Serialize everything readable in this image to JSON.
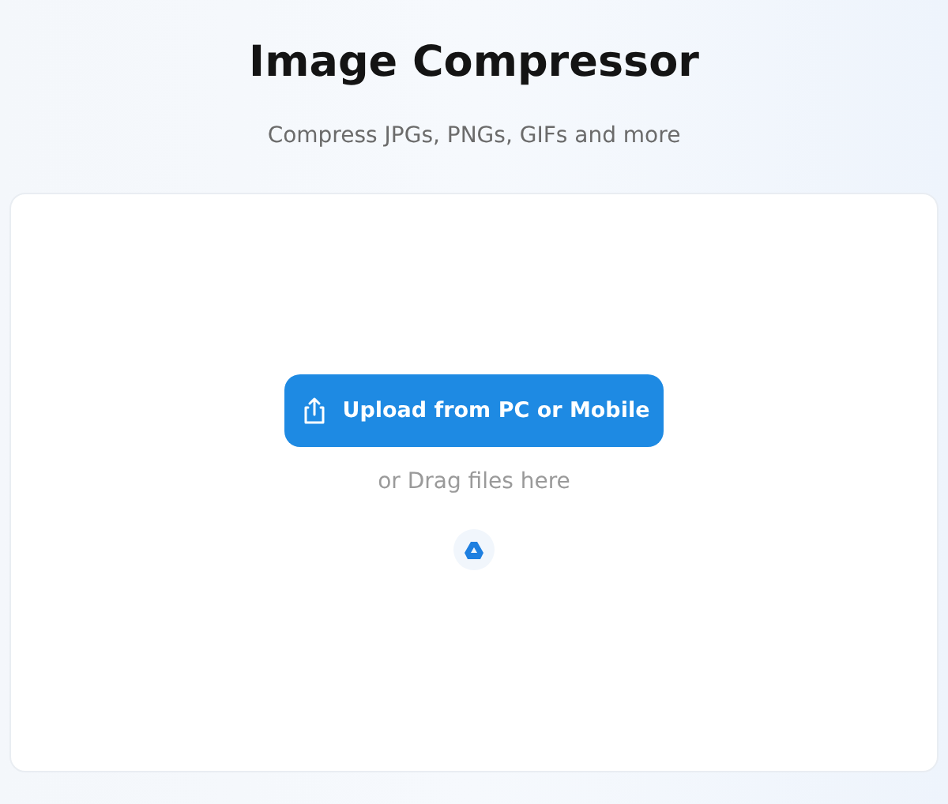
{
  "header": {
    "title": "Image Compressor",
    "subtitle": "Compress JPGs, PNGs, GIFs and more"
  },
  "upload": {
    "button": "Upload from PC or Mobile",
    "hint": "or Drag files here"
  }
}
